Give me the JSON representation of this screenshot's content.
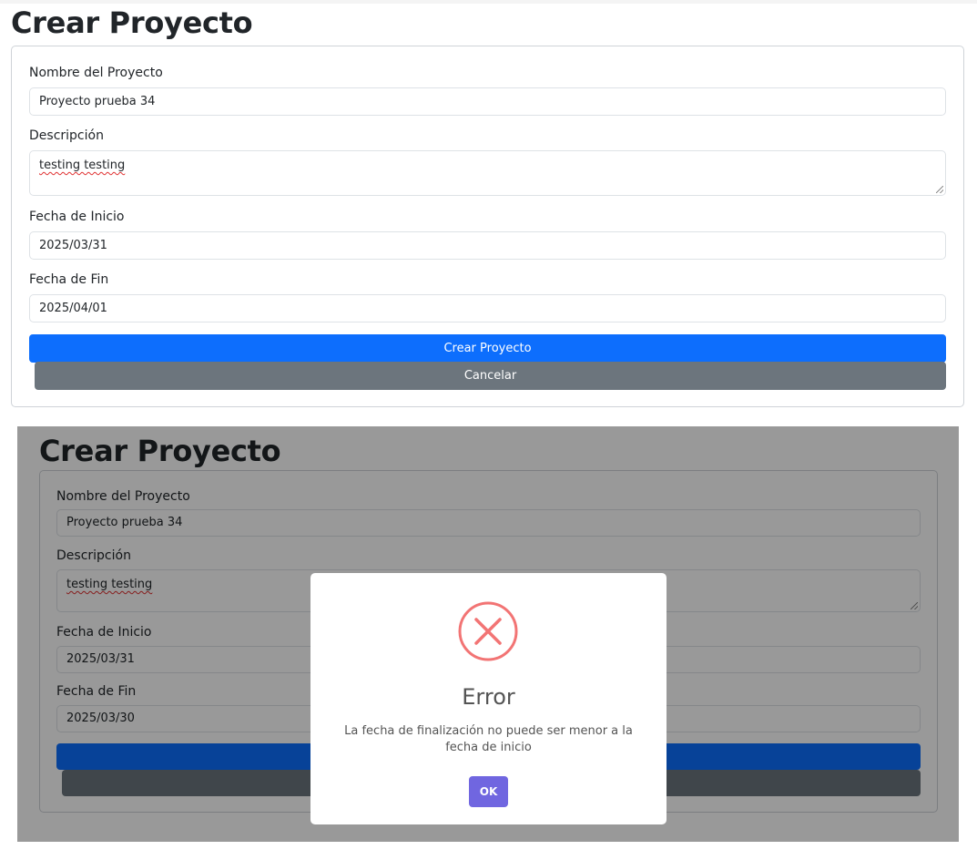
{
  "form_before": {
    "title": "Crear Proyecto",
    "name_label": "Nombre del Proyecto",
    "name_value": "Proyecto prueba 34",
    "description_label": "Descripción",
    "description_value": "testing testing",
    "start_label": "Fecha de Inicio",
    "start_value": "2025/03/31",
    "end_label": "Fecha de Fin",
    "end_value": "2025/04/01",
    "create_button": "Crear Proyecto",
    "cancel_button": "Cancelar"
  },
  "form_after": {
    "title": "Crear Proyecto",
    "name_label": "Nombre del Proyecto",
    "name_value": "Proyecto prueba 34",
    "description_label": "Descripción",
    "description_value": "testing testing",
    "start_label": "Fecha de Inicio",
    "start_value": "2025/03/31",
    "end_label": "Fecha de Fin",
    "end_value": "2025/03/30"
  },
  "dialog": {
    "icon": "error-x-icon",
    "title": "Error",
    "message": "La fecha de finalización no puede ser menor a la fecha de inicio",
    "ok_button": "OK"
  },
  "colors": {
    "primary": "#0d6efd",
    "secondary": "#6c757d",
    "error_icon": "#f27474",
    "dialog_button": "#7066e0"
  }
}
